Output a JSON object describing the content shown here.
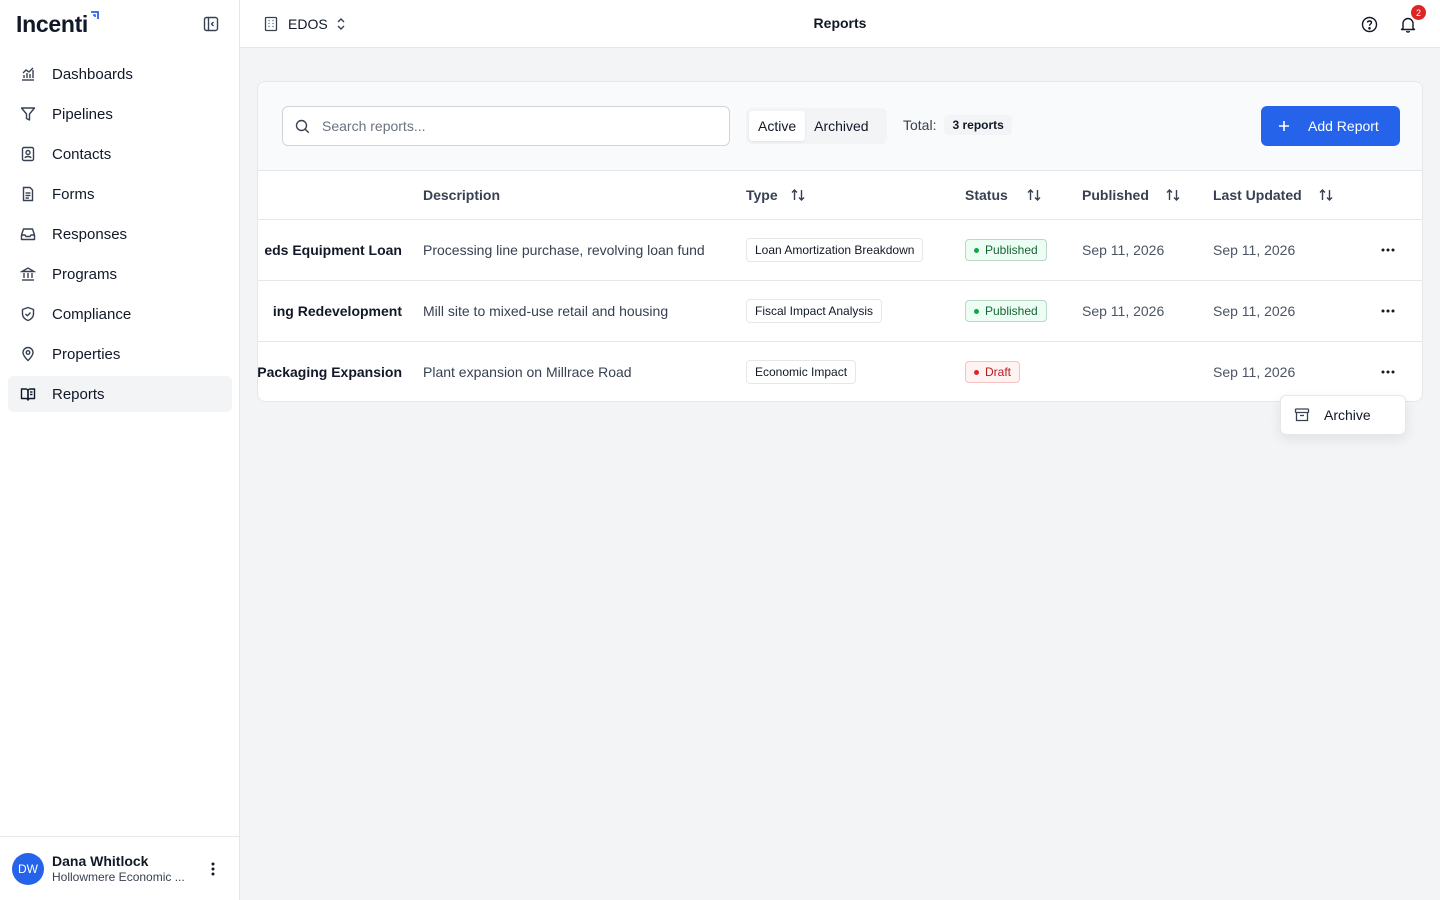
{
  "app": {
    "name": "Incenti"
  },
  "sidebar": {
    "items": [
      {
        "label": "Dashboards",
        "icon": "chart-icon"
      },
      {
        "label": "Pipelines",
        "icon": "filter-icon"
      },
      {
        "label": "Contacts",
        "icon": "contact-card-icon"
      },
      {
        "label": "Forms",
        "icon": "document-icon"
      },
      {
        "label": "Responses",
        "icon": "inbox-icon"
      },
      {
        "label": "Programs",
        "icon": "bank-icon"
      },
      {
        "label": "Compliance",
        "icon": "shield-check-icon"
      },
      {
        "label": "Properties",
        "icon": "map-pin-icon"
      },
      {
        "label": "Reports",
        "icon": "book-open-icon",
        "active": true
      }
    ],
    "user": {
      "initials": "DW",
      "name": "Dana Whitlock",
      "org": "Hollowmere Economic ..."
    }
  },
  "header": {
    "workspace": "EDOS",
    "title": "Reports",
    "notifications": "2"
  },
  "toolbar": {
    "search_placeholder": "Search reports...",
    "tabs": [
      "Active",
      "Archived"
    ],
    "active_tab": "Active",
    "total_label": "Total:",
    "total_value": "3 reports",
    "add_label": "Add Report"
  },
  "table": {
    "columns": [
      "Description",
      "Type",
      "Status",
      "Published",
      "Last Updated"
    ],
    "rows": [
      {
        "name": "eds Equipment Loan",
        "description": "Processing line purchase, revolving loan fund",
        "type": "Loan Amortization Breakdown",
        "status": "Published",
        "published": "Sep 11, 2026",
        "updated": "Sep 11, 2026"
      },
      {
        "name": "ing Redevelopment",
        "description": "Mill site to mixed-use retail and housing",
        "type": "Fiscal Impact Analysis",
        "status": "Published",
        "published": "Sep 11, 2026",
        "updated": "Sep 11, 2026"
      },
      {
        "name": "Packaging Expansion",
        "description": "Plant expansion on Millrace Road",
        "type": "Economic Impact",
        "status": "Draft",
        "published": "",
        "updated": "Sep 11, 2026"
      }
    ]
  },
  "row_menu": {
    "archive_label": "Archive"
  },
  "colors": {
    "accent": "#2563eb",
    "published_bg": "#ecfdf3",
    "published_text": "#166534",
    "draft_bg": "#fef2f2",
    "draft_text": "#b91c1c",
    "badge_red": "#dc2626"
  }
}
